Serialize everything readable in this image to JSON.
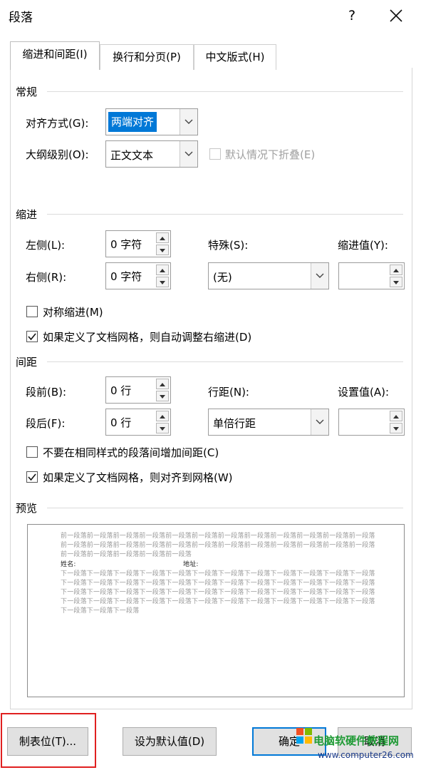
{
  "window": {
    "title": "段落",
    "help": "?"
  },
  "tabs": [
    {
      "label": "缩进和间距(I)"
    },
    {
      "label": "换行和分页(P)"
    },
    {
      "label": "中文版式(H)"
    }
  ],
  "general": {
    "title": "常规",
    "alignment_label": "对齐方式(G):",
    "alignment_value": "两端对齐",
    "outline_label": "大纲级别(O):",
    "outline_value": "正文文本",
    "collapse_label": "默认情况下折叠(E)"
  },
  "indent": {
    "title": "缩进",
    "left_label": "左侧(L):",
    "left_value": "0 字符",
    "right_label": "右侧(R):",
    "right_value": "0 字符",
    "special_label": "特殊(S):",
    "special_value": "(无)",
    "by_label": "缩进值(Y):",
    "by_value": "",
    "mirror_label": "对称缩进(M)",
    "mirror_checked": false,
    "grid_label": "如果定义了文档网格，则自动调整右缩进(D)",
    "grid_checked": true
  },
  "spacing": {
    "title": "间距",
    "before_label": "段前(B):",
    "before_value": "0 行",
    "after_label": "段后(F):",
    "after_value": "0 行",
    "line_label": "行距(N):",
    "line_value": "单倍行距",
    "at_label": "设置值(A):",
    "at_value": "",
    "nospace_label": "不要在相同样式的段落间增加间距(C)",
    "nospace_checked": false,
    "snap_label": "如果定义了文档网格，则对齐到网格(W)",
    "snap_checked": true
  },
  "preview": {
    "title": "预览",
    "prev_lines": [
      "前一段落前一段落前一段落前一段落前一段落前一段落前一段落前一段落前一段落前一段落前一段落前一段落",
      "前一段落前一段落前一段落前一段落前一段落前一段落前一段落前一段落前一段落前一段落前一段落前一段落",
      "前一段落前一段落前一段落前一段落前一段落"
    ],
    "sample_name": "姓名:",
    "sample_addr": "地址:",
    "next_lines": [
      "下一段落下一段落下一段落下一段落下一段落下一段落下一段落下一段落下一段落下一段落下一段落下一段落",
      "下一段落下一段落下一段落下一段落下一段落下一段落下一段落下一段落下一段落下一段落下一段落下一段落",
      "下一段落下一段落下一段落下一段落下一段落下一段落下一段落下一段落下一段落下一段落下一段落下一段落",
      "下一段落下一段落下一段落下一段落下一段落下一段落下一段落下一段落下一段落下一段落下一段落下一段落",
      "下一段落下一段落下一段落"
    ]
  },
  "buttons": {
    "tabs": "制表位(T)...",
    "default": "设为默认值(D)",
    "ok": "确定",
    "cancel": "取消"
  },
  "watermark": {
    "text": "电脑软硬件教程网",
    "url": "www.computer26.com"
  }
}
